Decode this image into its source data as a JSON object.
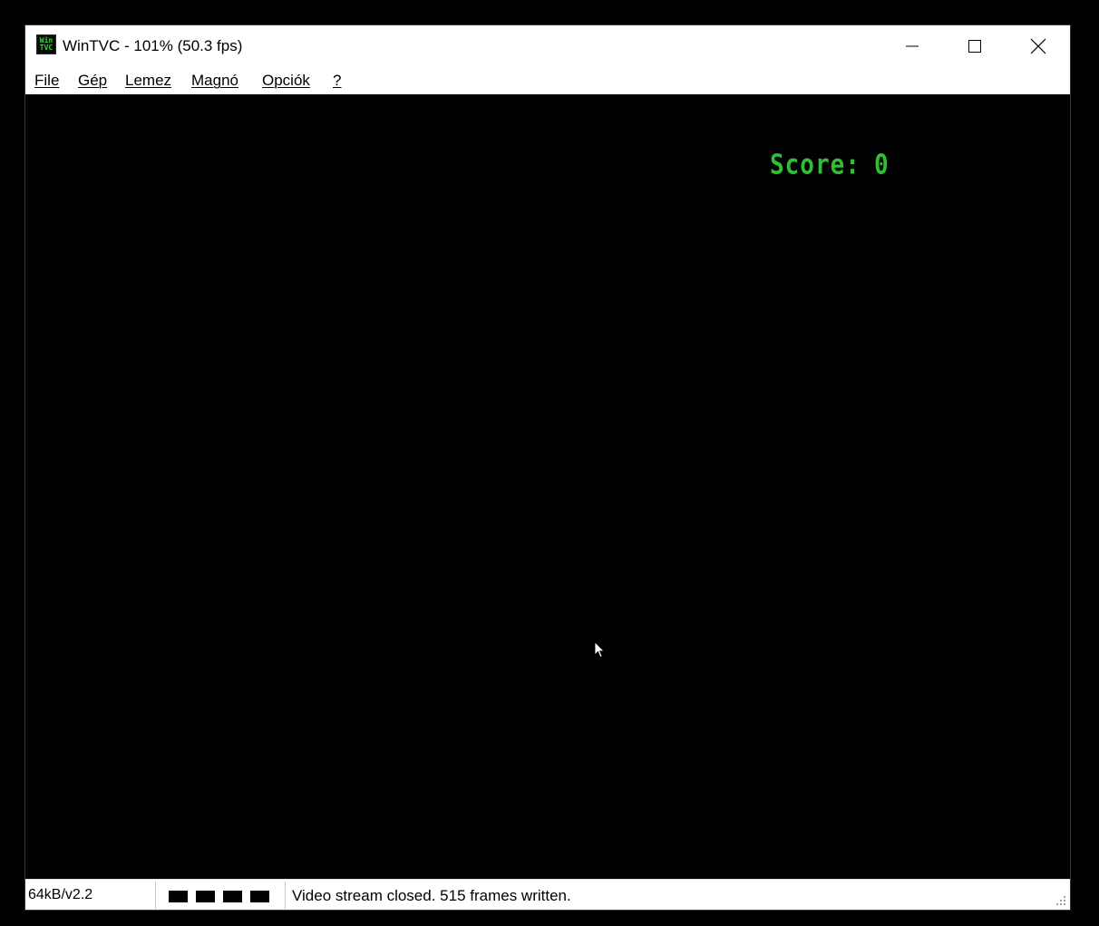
{
  "window": {
    "title": "WinTVC - 101% (50.3 fps)",
    "icon_text_line1": "Win",
    "icon_text_line2": "TVC",
    "icon": "wintvc-app-icon",
    "controls": {
      "minimize_icon": "minimize-icon",
      "maximize_icon": "maximize-icon",
      "close_icon": "close-icon"
    }
  },
  "menu": {
    "items": [
      {
        "label": "File"
      },
      {
        "label": "Gép"
      },
      {
        "label": "Lemez"
      },
      {
        "label": "Magnó"
      },
      {
        "label": "Opciók"
      },
      {
        "label": "?"
      }
    ]
  },
  "screen": {
    "score_label": "Score:",
    "score_value": "0",
    "text_color": "#2fc033",
    "background": "#000000",
    "cursor_icon": "mouse-pointer-icon"
  },
  "statusbar": {
    "memory_version": "64kB/v2.2",
    "leds": [
      {
        "state": "off"
      },
      {
        "state": "off"
      },
      {
        "state": "off"
      },
      {
        "state": "off"
      }
    ],
    "message": "Video stream closed. 515 frames written."
  }
}
